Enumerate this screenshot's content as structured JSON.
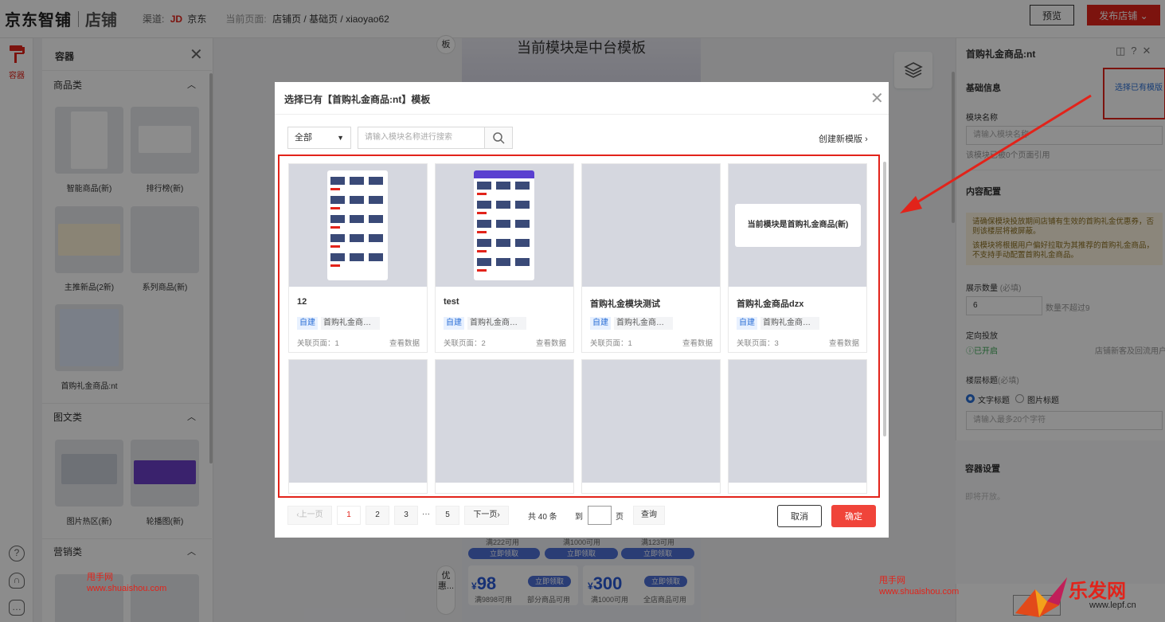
{
  "header": {
    "logo": "京东智铺",
    "logo_sub": "店铺",
    "channel_label": "渠道:",
    "channel_brand": "JD",
    "channel_name": "京东",
    "current_page_label": "当前页面:",
    "current_page_path": "店铺页 / 基础页 / xiaoyao62",
    "preview_button": "预览",
    "publish_button": "发布店铺"
  },
  "rail": {
    "container_label": "容器",
    "help_icon": "question-icon",
    "service_icon": "headset-icon",
    "feedback_icon": "chat-icon"
  },
  "left_panel": {
    "title": "容器",
    "sections": [
      {
        "name": "商品类",
        "items": [
          "智能商品(新)",
          "排行榜(新)",
          "主推新品(2新)",
          "系列商品(新)",
          "首购礼金商品:nt"
        ]
      },
      {
        "name": "图文类",
        "items": [
          "图片热区(新)",
          "轮播图(新)"
        ]
      },
      {
        "name": "营销类",
        "items": []
      }
    ]
  },
  "canvas": {
    "side_tab_top": "板",
    "module_title": "当前模块是中台模板",
    "side_tab_bottom": "优惠...",
    "coupons_row1": [
      {
        "cond": "满222可用",
        "btn": "立即领取"
      },
      {
        "cond": "满1000可用",
        "btn": "立即领取"
      },
      {
        "cond": "满123可用",
        "btn": "立即领取"
      }
    ],
    "coupons_row2": [
      {
        "amount": "98",
        "cond": "满9898可用",
        "scope": "部分商品可用",
        "btn": "立即领取"
      },
      {
        "amount": "300",
        "cond": "满1000可用",
        "scope": "全店商品可用",
        "btn": "立即领取"
      }
    ],
    "currency": "¥"
  },
  "right_panel": {
    "title": "首购礼金商品:nt",
    "basic_info": "基础信息",
    "select_existing_link": "选择已有模版",
    "module_name_label": "模块名称",
    "module_name_placeholder": "请输入模块名称",
    "module_name_hint": "该模块已被0个页面引用",
    "content_config": "内容配置",
    "warning_1": "请确保模块投放期间店铺有生效的首购礼金优惠券，否则该楼层将被屏蔽。",
    "warning_2": "该模块将根据用户偏好拉取为其推荐的首购礼金商品，不支持手动配置首购礼金商品。",
    "display_count_label": "展示数量",
    "required_mark": "(必填)",
    "display_count_value": "6",
    "display_count_hint": "数量不超过9",
    "targeting_label": "定向投放",
    "targeting_status": "已开启",
    "targeting_audience": "店铺新客及回流用户",
    "floor_title_label": "楼层标题",
    "radio_text_title": "文字标题",
    "radio_image_title": "图片标题",
    "floor_title_placeholder": "请输入最多20个字符",
    "container_settings": "容器设置",
    "container_settings_hint": "即将开放。",
    "cancel_button_partial": "取消"
  },
  "watermarks": {
    "left_name": "甩手网",
    "left_url": "www.shuaishou.com",
    "right_name": "甩手网",
    "right_url": "www.shuaishou.com",
    "logo_text": "乐发网",
    "logo_url": "www.lepf.cn"
  },
  "modal": {
    "title": "选择已有【首购礼金商品:nt】模板",
    "filter_value": "全部",
    "search_placeholder": "请输入模块名称进行搜索",
    "create_new": "创建新模版",
    "cards": [
      {
        "name": "12",
        "tag": "自建",
        "category": "首购礼金商品...",
        "rel_label": "关联页面：",
        "rel_count": "1",
        "view": "查看数据",
        "thumb": "screenshot"
      },
      {
        "name": "test",
        "tag": "自建",
        "category": "首购礼金商品...",
        "rel_label": "关联页面：",
        "rel_count": "2",
        "view": "查看数据",
        "thumb": "screenshot"
      },
      {
        "name": "首购礼金模块测试",
        "tag": "自建",
        "category": "首购礼金商品...",
        "rel_label": "关联页面：",
        "rel_count": "1",
        "view": "查看数据",
        "thumb": "empty"
      },
      {
        "name": "首购礼金商品dzx",
        "tag": "自建",
        "category": "首购礼金商品...",
        "rel_label": "关联页面：",
        "rel_count": "3",
        "view": "查看数据",
        "thumb": "banner",
        "banner_text": "当前模块是首购礼金商品(新)"
      }
    ],
    "pagination": {
      "prev": "上一页",
      "pages": [
        "1",
        "2",
        "3",
        "5"
      ],
      "ellipsis": "···",
      "next": "下一页",
      "total": "共 40 条",
      "goto": "到",
      "page_unit": "页",
      "query": "查询"
    },
    "cancel": "取消",
    "confirm": "确定"
  },
  "colors": {
    "brand_red": "#e2231a",
    "link_blue": "#2b6fd6"
  }
}
